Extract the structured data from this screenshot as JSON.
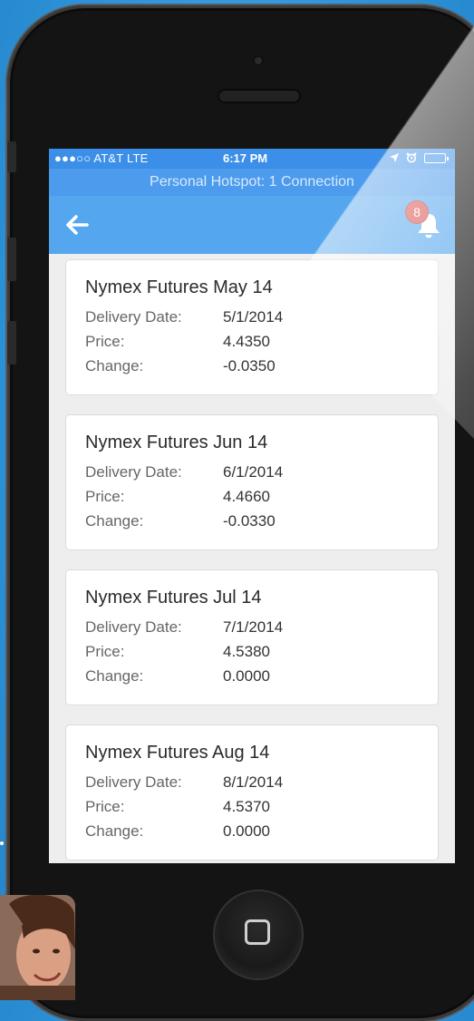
{
  "status_bar": {
    "carrier": "●●●○○ AT&T  LTE",
    "time": "6:17 PM"
  },
  "hotspot": {
    "text": "Personal Hotspot: 1 Connection"
  },
  "nav": {
    "back_icon": "back-arrow-icon",
    "notification_icon": "bell-icon",
    "notification_count": "8"
  },
  "labels": {
    "delivery_date": "Delivery Date:",
    "price": "Price:",
    "change": "Change:"
  },
  "futures": [
    {
      "title": "Nymex Futures May 14",
      "delivery_date": "5/1/2014",
      "price": "4.4350",
      "change": "-0.0350"
    },
    {
      "title": "Nymex Futures Jun 14",
      "delivery_date": "6/1/2014",
      "price": "4.4660",
      "change": "-0.0330"
    },
    {
      "title": "Nymex Futures Jul 14",
      "delivery_date": "7/1/2014",
      "price": "4.5380",
      "change": "0.0000"
    },
    {
      "title": "Nymex Futures Aug 14",
      "delivery_date": "8/1/2014",
      "price": "4.5370",
      "change": "0.0000"
    }
  ],
  "colors": {
    "background": "#2f96dc",
    "status_bar": "#3b8fe8",
    "nav_bar": "#54a6ee",
    "badge": "#d9534f"
  }
}
